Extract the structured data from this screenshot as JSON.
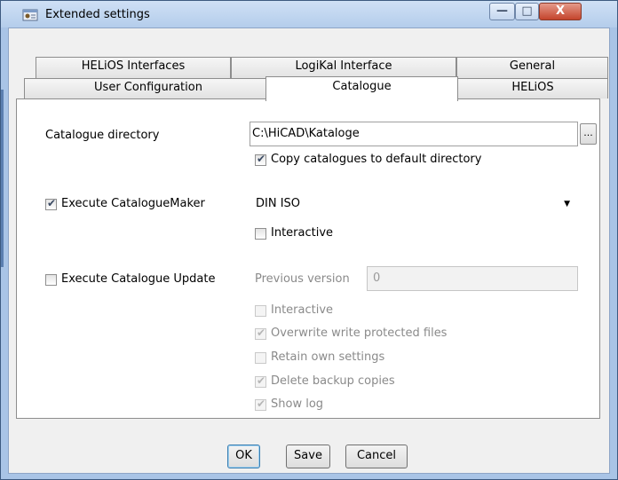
{
  "window": {
    "title": "Extended settings",
    "controls": {
      "minimize": "—",
      "maximize": "□",
      "close": "X"
    }
  },
  "tabs": {
    "row1": [
      "HELiOS Interfaces",
      "LogiKal Interface",
      "General"
    ],
    "row2": [
      "User Configuration",
      "Catalogue",
      "HELiOS"
    ],
    "active": "Catalogue"
  },
  "catalogue": {
    "directory_label": "Catalogue directory",
    "directory_value": "C:\\HiCAD\\Kataloge",
    "browse_label": "...",
    "copy_label": "Copy catalogues to default directory",
    "copy_checked": true,
    "maker_label": "Execute CatalogueMaker",
    "maker_checked": true,
    "maker_option": "DIN ISO",
    "maker_interactive_label": "Interactive",
    "maker_interactive_checked": false,
    "update_label": "Execute Catalogue Update",
    "update_checked": false,
    "prev_version_label": "Previous version",
    "prev_version_value": "0",
    "update_options": [
      {
        "label": "Interactive",
        "checked": false
      },
      {
        "label": "Overwrite write protected files",
        "checked": true
      },
      {
        "label": "Retain own settings",
        "checked": false
      },
      {
        "label": "Delete backup copies",
        "checked": true
      },
      {
        "label": "Show log",
        "checked": true
      }
    ]
  },
  "buttons": {
    "ok": "OK",
    "save": "Save",
    "cancel": "Cancel"
  },
  "icons": {
    "title": "settings-window-icon",
    "dropdown": "chevron-down-icon"
  }
}
